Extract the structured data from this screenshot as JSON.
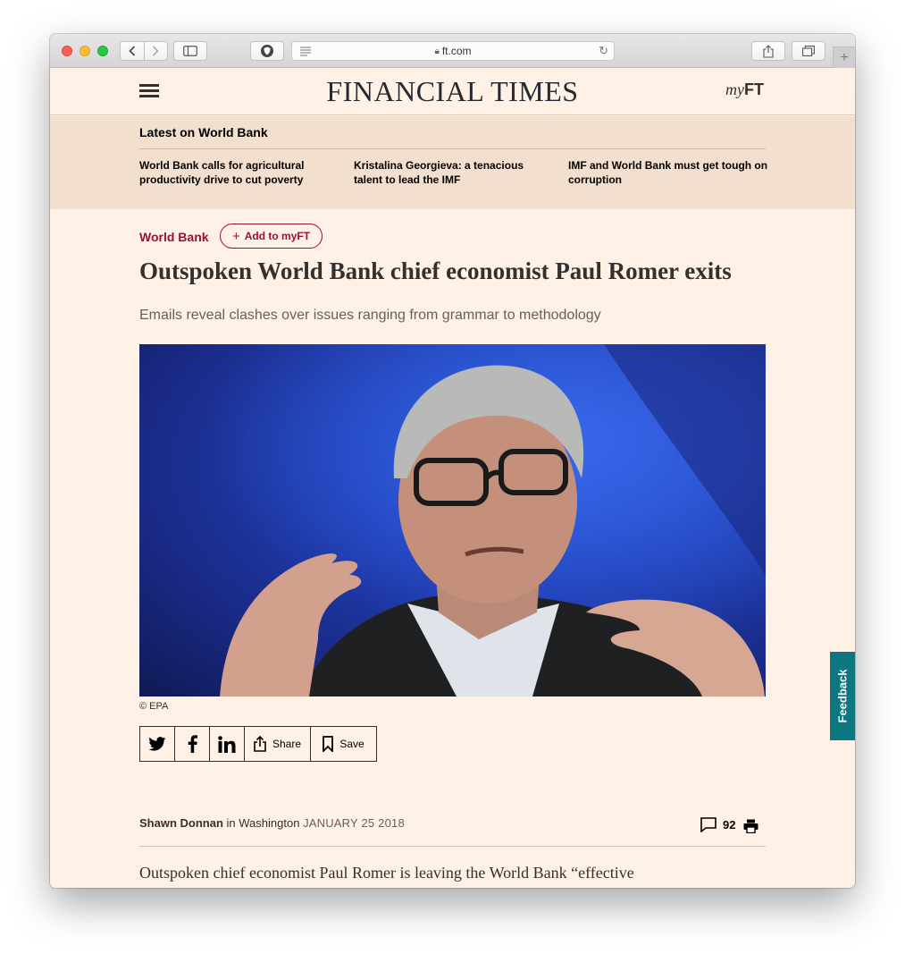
{
  "browser": {
    "url": "ft.com"
  },
  "header": {
    "masthead": "FINANCIAL TIMES",
    "myft_my": "my",
    "myft_ft": "FT"
  },
  "latest": {
    "title": "Latest on World Bank",
    "items": [
      "World Bank calls for agricultural productivity drive to cut poverty",
      "Kristalina Georgieva: a tenacious talent to lead the IMF",
      "IMF and World Bank must get tough on corruption"
    ]
  },
  "article": {
    "topic": "World Bank",
    "add_myft": "Add to myFT",
    "headline": "Outspoken World Bank chief economist Paul Romer exits",
    "standfirst": "Emails reveal clashes over issues ranging from grammar to methodology",
    "image_credit": "© EPA",
    "share_label": "Share",
    "save_label": "Save",
    "author": "Shawn Donnan",
    "location_prefix": "in",
    "location": "Washington",
    "date": "JANUARY 25 2018",
    "comment_count": "92",
    "body_first_line": "Outspoken chief economist Paul Romer is leaving the World Bank “effective"
  },
  "feedback": {
    "label": "Feedback"
  },
  "colors": {
    "page_bg": "#fff1e5",
    "latest_bg": "#f2dfce",
    "claret": "#990f3d",
    "feedback_teal": "#0d7680"
  },
  "icons": [
    "back-icon",
    "forward-icon",
    "sidebar-icon",
    "shield-icon",
    "reader-icon",
    "lock-icon",
    "reload-icon",
    "share-icon",
    "tabs-icon",
    "plus-icon",
    "hamburger-icon",
    "twitter-icon",
    "facebook-icon",
    "linkedin-icon",
    "bookmark-icon",
    "comment-icon",
    "print-icon"
  ]
}
